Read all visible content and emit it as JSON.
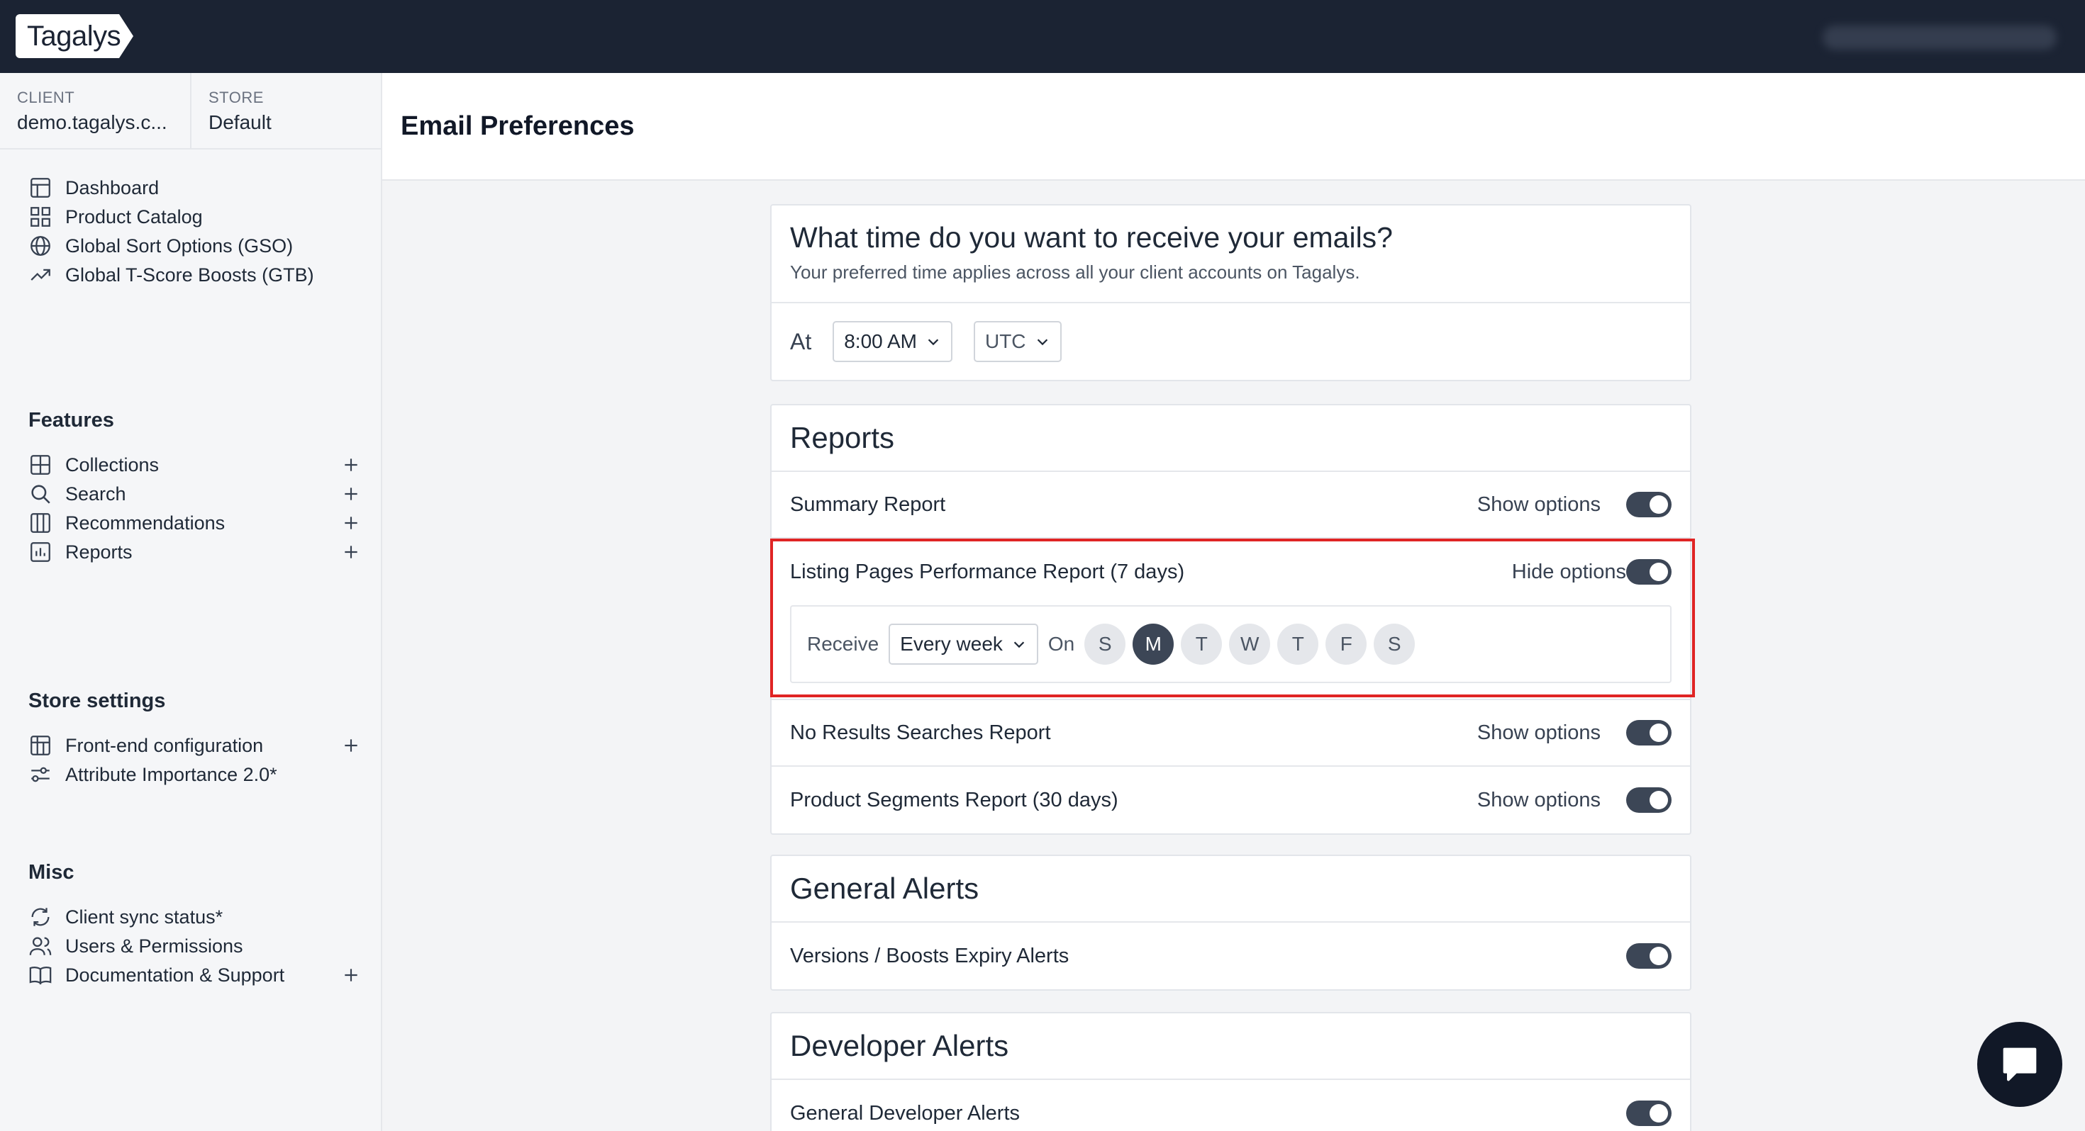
{
  "app": {
    "logo_text": "Tagalys"
  },
  "context": {
    "client_label": "CLIENT",
    "client_value": "demo.tagalys.c...",
    "store_label": "STORE",
    "store_value": "Default"
  },
  "sidebar": {
    "main_items": [
      {
        "label": "Dashboard",
        "icon": "dashboard-icon"
      },
      {
        "label": "Product Catalog",
        "icon": "grid-icon"
      },
      {
        "label": "Global Sort Options (GSO)",
        "icon": "globe-icon"
      },
      {
        "label": "Global T-Score Boosts (GTB)",
        "icon": "trending-up-icon"
      }
    ],
    "features_title": "Features",
    "features": [
      {
        "label": "Collections",
        "icon": "collections-icon"
      },
      {
        "label": "Search",
        "icon": "search-icon"
      },
      {
        "label": "Recommendations",
        "icon": "columns-icon"
      },
      {
        "label": "Reports",
        "icon": "bar-chart-icon"
      }
    ],
    "store_settings_title": "Store settings",
    "store_settings": [
      {
        "label": "Front-end configuration",
        "icon": "layout-icon"
      },
      {
        "label": "Attribute Importance 2.0*",
        "icon": "sliders-icon"
      }
    ],
    "misc_title": "Misc",
    "misc": [
      {
        "label": "Client sync status*",
        "icon": "refresh-icon"
      },
      {
        "label": "Users & Permissions",
        "icon": "users-icon"
      },
      {
        "label": "Documentation & Support",
        "icon": "book-icon"
      }
    ]
  },
  "page": {
    "title": "Email Preferences"
  },
  "time_card": {
    "title": "What time do you want to receive your emails?",
    "subtitle": "Your preferred time applies across all your client accounts on Tagalys.",
    "at_label": "At",
    "time_value": "8:00 AM",
    "timezone_value": "UTC"
  },
  "reports": {
    "title": "Reports",
    "items": [
      {
        "name": "Summary Report",
        "option_label": "Show options",
        "enabled": true
      },
      {
        "name": "Listing Pages Performance Report (7 days)",
        "option_label": "Hide options",
        "enabled": true
      },
      {
        "name": "No Results Searches Report",
        "option_label": "Show options",
        "enabled": true
      },
      {
        "name": "Product Segments Report (30 days)",
        "option_label": "Show options",
        "enabled": true
      }
    ],
    "expanded": {
      "receive_label": "Receive",
      "frequency_value": "Every week",
      "on_label": "On",
      "days": [
        "S",
        "M",
        "T",
        "W",
        "T",
        "F",
        "S"
      ],
      "selected_day_index": 1
    }
  },
  "general_alerts": {
    "title": "General Alerts",
    "items": [
      {
        "name": "Versions / Boosts Expiry Alerts",
        "enabled": true
      }
    ]
  },
  "developer_alerts": {
    "title": "Developer Alerts",
    "items": [
      {
        "name": "General Developer Alerts",
        "enabled": true
      }
    ]
  },
  "colors": {
    "topbar": "#1b2333",
    "toggle_on": "#3c4656",
    "highlight_border": "#e02424"
  }
}
